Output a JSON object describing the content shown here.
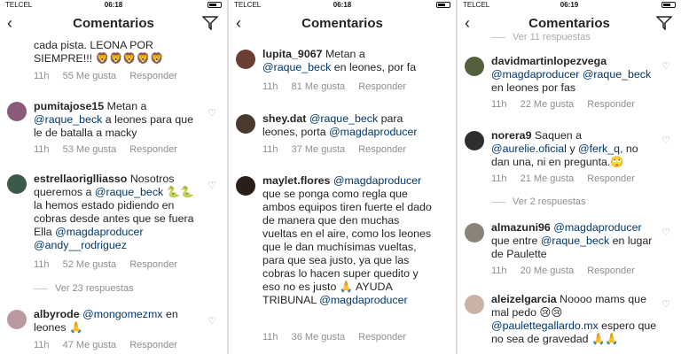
{
  "panels": [
    {
      "status": {
        "carrier": "TELCEL",
        "time": "06:18"
      },
      "header": {
        "title": "Comentarios"
      },
      "comments": [
        {
          "user": "",
          "text": "cada pista. LEONA POR SIEMPRE!!! 🦁🦁🦁🦁🦁",
          "time": "11h",
          "likes": "55 Me gusta",
          "reply": "Responder"
        },
        {
          "user": "pumitajose15",
          "text": "Metan a @raque_beck a leones para que le de batalla a macky",
          "time": "11h",
          "likes": "53 Me gusta",
          "reply": "Responder"
        },
        {
          "user": "estrellaoriglliasso",
          "text": "Nosotros queremos a @raque_beck 🐍🐍 la hemos estado pidiendo en cobras desde antes que se fuera Ella @magdaproducer @andy__rodriguez",
          "time": "11h",
          "likes": "52 Me gusta",
          "reply": "Responder",
          "more": "Ver 23 respuestas"
        },
        {
          "user": "albyrode",
          "text": "@mongomezmx en leones 🙏",
          "time": "11h",
          "likes": "47 Me gusta",
          "reply": "Responder"
        }
      ]
    },
    {
      "status": {
        "carrier": "TELCEL",
        "time": "06:18"
      },
      "header": {
        "title": "Comentarios"
      },
      "comments": [
        {
          "user": "lupita_9067",
          "text": "Metan a @raque_beck en leones, por fa",
          "time": "11h",
          "likes": "81 Me gusta",
          "reply": "Responder"
        },
        {
          "user": "shey.dat",
          "text": "@raque_beck para leones, porta @magdaproducer",
          "time": "11h",
          "likes": "37 Me gusta",
          "reply": "Responder"
        },
        {
          "user": "maylet.flores",
          "text": "@magdaproducer que se ponga como regla que ambos equipos tiren fuerte el dado de manera que den muchas vueltas en el aire, como los leones que le dan muchísimas vueltas, para que sea justo, ya que las cobras lo hacen super quedito y eso no es justo 🙏 AYUDA TRIBUNAL @magdaproducer",
          "time": "11h",
          "likes": "36 Me gusta",
          "reply": "Responder"
        }
      ]
    },
    {
      "status": {
        "carrier": "TELCEL",
        "time": "06:19"
      },
      "header": {
        "title": "Comentarios"
      },
      "comments": [
        {
          "user": "",
          "text": "Ver 11 respuestas",
          "time": "",
          "likes": "",
          "reply": ""
        },
        {
          "user": "davidmartinlopezvega",
          "text": "@magdaproducer @raque_beck en leones por fas",
          "time": "11h",
          "likes": "22 Me gusta",
          "reply": "Responder"
        },
        {
          "user": "norera9",
          "text": "Saquen a @aurelie.oficial y @ferk_q, no dan una, ni en pregunta.🙄",
          "time": "11h",
          "likes": "21 Me gusta",
          "reply": "Responder",
          "more": "Ver 2 respuestas"
        },
        {
          "user": "almazuni96",
          "text": "@magdaproducer que entre @raque_beck en lugar de Paulette",
          "time": "11h",
          "likes": "20 Me gusta",
          "reply": "Responder"
        },
        {
          "user": "aleizelgarcia",
          "text": "Noooo mams que mal pedo 😢😢 @paulettegallardo.mx espero que no sea de gravedad 🙏🙏",
          "time": "",
          "likes": "",
          "reply": ""
        }
      ]
    }
  ]
}
